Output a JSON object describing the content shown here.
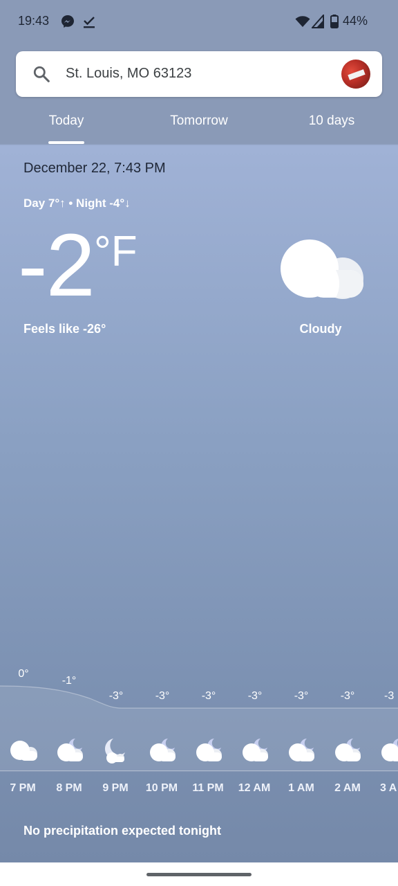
{
  "status_bar": {
    "time": "19:43",
    "battery": "44%",
    "icons": [
      "messenger-icon",
      "download-done-icon",
      "wifi-icon",
      "cell-signal-icon",
      "battery-icon"
    ]
  },
  "search": {
    "location": "St. Louis, MO 63123",
    "icon": "search-icon"
  },
  "tabs": [
    {
      "label": "Today",
      "selected": true
    },
    {
      "label": "Tomorrow",
      "selected": false
    },
    {
      "label": "10 days",
      "selected": false
    }
  ],
  "current": {
    "date_time": "December 22, 7:43 PM",
    "day_night": "Day 7°↑ • Night -4°↓",
    "temperature": "-2",
    "unit": "°F",
    "feels_like": "Feels like -26°",
    "condition": "Cloudy",
    "condition_icon": "cloud-icon"
  },
  "hourly": [
    {
      "time": "7 PM",
      "temp": "0°",
      "icon": "cloud-icon"
    },
    {
      "time": "8 PM",
      "temp": "-1°",
      "icon": "cloud-moon-icon"
    },
    {
      "time": "9 PM",
      "temp": "-3°",
      "icon": "moon-cloud-icon"
    },
    {
      "time": "10 PM",
      "temp": "-3°",
      "icon": "cloud-moon-icon"
    },
    {
      "time": "11 PM",
      "temp": "-3°",
      "icon": "cloud-moon-icon"
    },
    {
      "time": "12 AM",
      "temp": "-3°",
      "icon": "cloud-moon-icon"
    },
    {
      "time": "1 AM",
      "temp": "-3°",
      "icon": "cloud-moon-icon"
    },
    {
      "time": "2 AM",
      "temp": "-3°",
      "icon": "cloud-moon-icon"
    },
    {
      "time": "3 A",
      "temp": "-3",
      "icon": "cloud-moon-icon"
    }
  ],
  "precipitation": "No precipitation expected tonight",
  "colors": {
    "sky_top": "#a0b2d6",
    "sky_bottom": "#7589a9",
    "header": "#8a9ab7"
  }
}
